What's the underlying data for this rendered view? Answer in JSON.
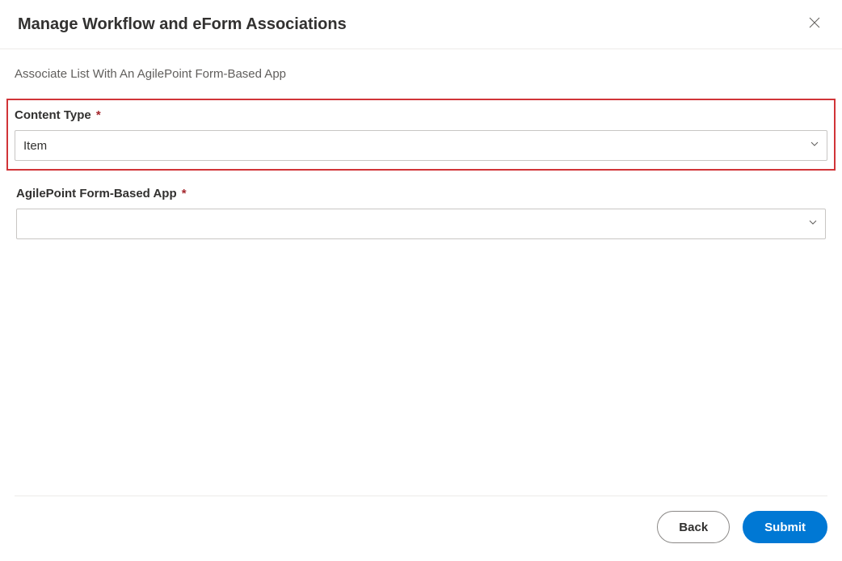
{
  "header": {
    "title": "Manage Workflow and eForm Associations"
  },
  "subtitle": "Associate List With An AgilePoint Form-Based App",
  "fields": {
    "contentType": {
      "label": "Content Type",
      "required": "*",
      "value": "Item"
    },
    "formApp": {
      "label": "AgilePoint Form-Based App",
      "required": "*",
      "value": ""
    }
  },
  "footer": {
    "back": "Back",
    "submit": "Submit"
  }
}
